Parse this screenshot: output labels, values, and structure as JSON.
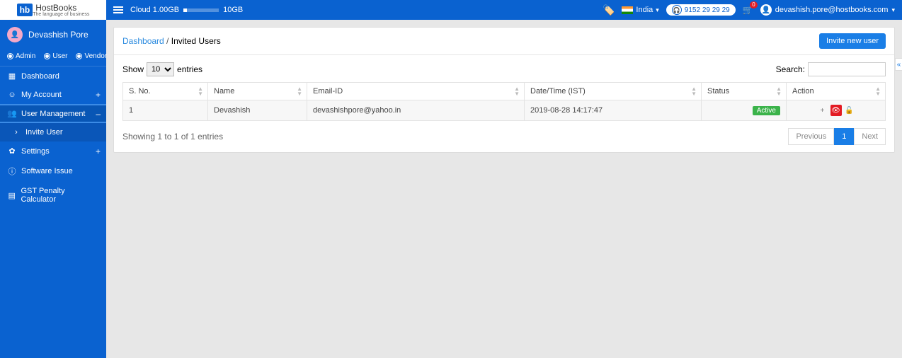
{
  "topbar": {
    "cloud_label": "Cloud 1.00GB",
    "cloud_max": "10GB",
    "country": "India",
    "phone": "9152 29 29 29",
    "cart_count": "0",
    "user_email": "devashish.pore@hostbooks.com"
  },
  "logo": {
    "brand": "HostBooks",
    "tag": "The language of business",
    "hb": "hb"
  },
  "sidebar": {
    "user_name": "Devashish Pore",
    "roles": [
      {
        "label": "Admin",
        "selected": true
      },
      {
        "label": "User",
        "selected": false
      },
      {
        "label": "Vendor",
        "selected": false
      }
    ],
    "items": [
      {
        "icon": "dashboard-icon",
        "label": "Dashboard",
        "exp": ""
      },
      {
        "icon": "account-icon",
        "label": "My Account",
        "exp": "+"
      },
      {
        "icon": "users-icon",
        "label": "User Management",
        "exp": "–",
        "active": true
      },
      {
        "icon": "chevron-right-icon",
        "label": "Invite User",
        "exp": "",
        "sub": true
      },
      {
        "icon": "gear-icon",
        "label": "Settings",
        "exp": "+"
      },
      {
        "icon": "info-icon",
        "label": "Software Issue",
        "exp": ""
      },
      {
        "icon": "doc-icon",
        "label": "GST Penalty Calculator",
        "exp": ""
      }
    ]
  },
  "breadcrumb": {
    "root": "Dashboard",
    "sep": " / ",
    "current": "Invited Users"
  },
  "buttons": {
    "invite": "Invite new user"
  },
  "table": {
    "show_pre": "Show",
    "show_post": "entries",
    "show_val": "10",
    "search_label": "Search:",
    "headers": [
      "S. No.",
      "Name",
      "Email-ID",
      "Date/Time (IST)",
      "Status",
      "Action"
    ],
    "rows": [
      {
        "sno": "1",
        "name": "Devashish",
        "email": "devashishpore@yahoo.in",
        "dt": "2019-08-28 14:17:47",
        "status": "Active"
      }
    ],
    "info": "Showing 1 to 1 of 1 entries",
    "pager": {
      "prev": "Previous",
      "pages": [
        "1"
      ],
      "next": "Next"
    }
  }
}
